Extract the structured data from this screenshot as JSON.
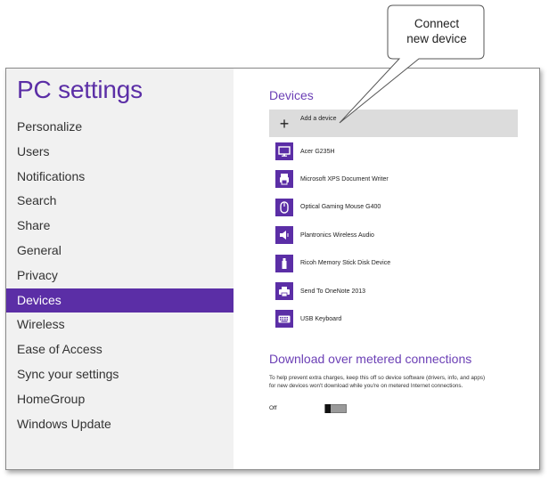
{
  "app": {
    "title": "PC settings"
  },
  "sidebar": {
    "items": [
      {
        "label": "Personalize"
      },
      {
        "label": "Users"
      },
      {
        "label": "Notifications"
      },
      {
        "label": "Search"
      },
      {
        "label": "Share"
      },
      {
        "label": "General"
      },
      {
        "label": "Privacy"
      },
      {
        "label": "Devices",
        "selected": true
      },
      {
        "label": "Wireless"
      },
      {
        "label": "Ease of Access"
      },
      {
        "label": "Sync your settings"
      },
      {
        "label": "HomeGroup"
      },
      {
        "label": "Windows Update"
      }
    ]
  },
  "devices": {
    "heading": "Devices",
    "add_label": "Add a device",
    "items": [
      {
        "label": "Acer G235H",
        "icon": "monitor-icon"
      },
      {
        "label": "Microsoft XPS Document Writer",
        "icon": "document-printer-icon"
      },
      {
        "label": "Optical Gaming Mouse G400",
        "icon": "mouse-icon"
      },
      {
        "label": "Plantronics Wireless Audio",
        "icon": "speaker-icon"
      },
      {
        "label": "Ricoh Memory Stick Disk Device",
        "icon": "usb-drive-icon"
      },
      {
        "label": "Send To OneNote 2013",
        "icon": "printer-icon"
      },
      {
        "label": "USB Keyboard",
        "icon": "keyboard-icon"
      }
    ]
  },
  "metered": {
    "heading": "Download over metered connections",
    "description": "To help prevent extra charges, keep this off so device software (drivers, info, and apps) for new devices won't download while you're on metered Internet connections.",
    "toggle_label": "Off",
    "toggle_on": false
  },
  "callout": {
    "line1": "Connect",
    "line2": "new device"
  },
  "colors": {
    "accent": "#5b2ea6",
    "sidebar_bg": "#f1f1f1",
    "add_row_bg": "#dcdcdc"
  }
}
